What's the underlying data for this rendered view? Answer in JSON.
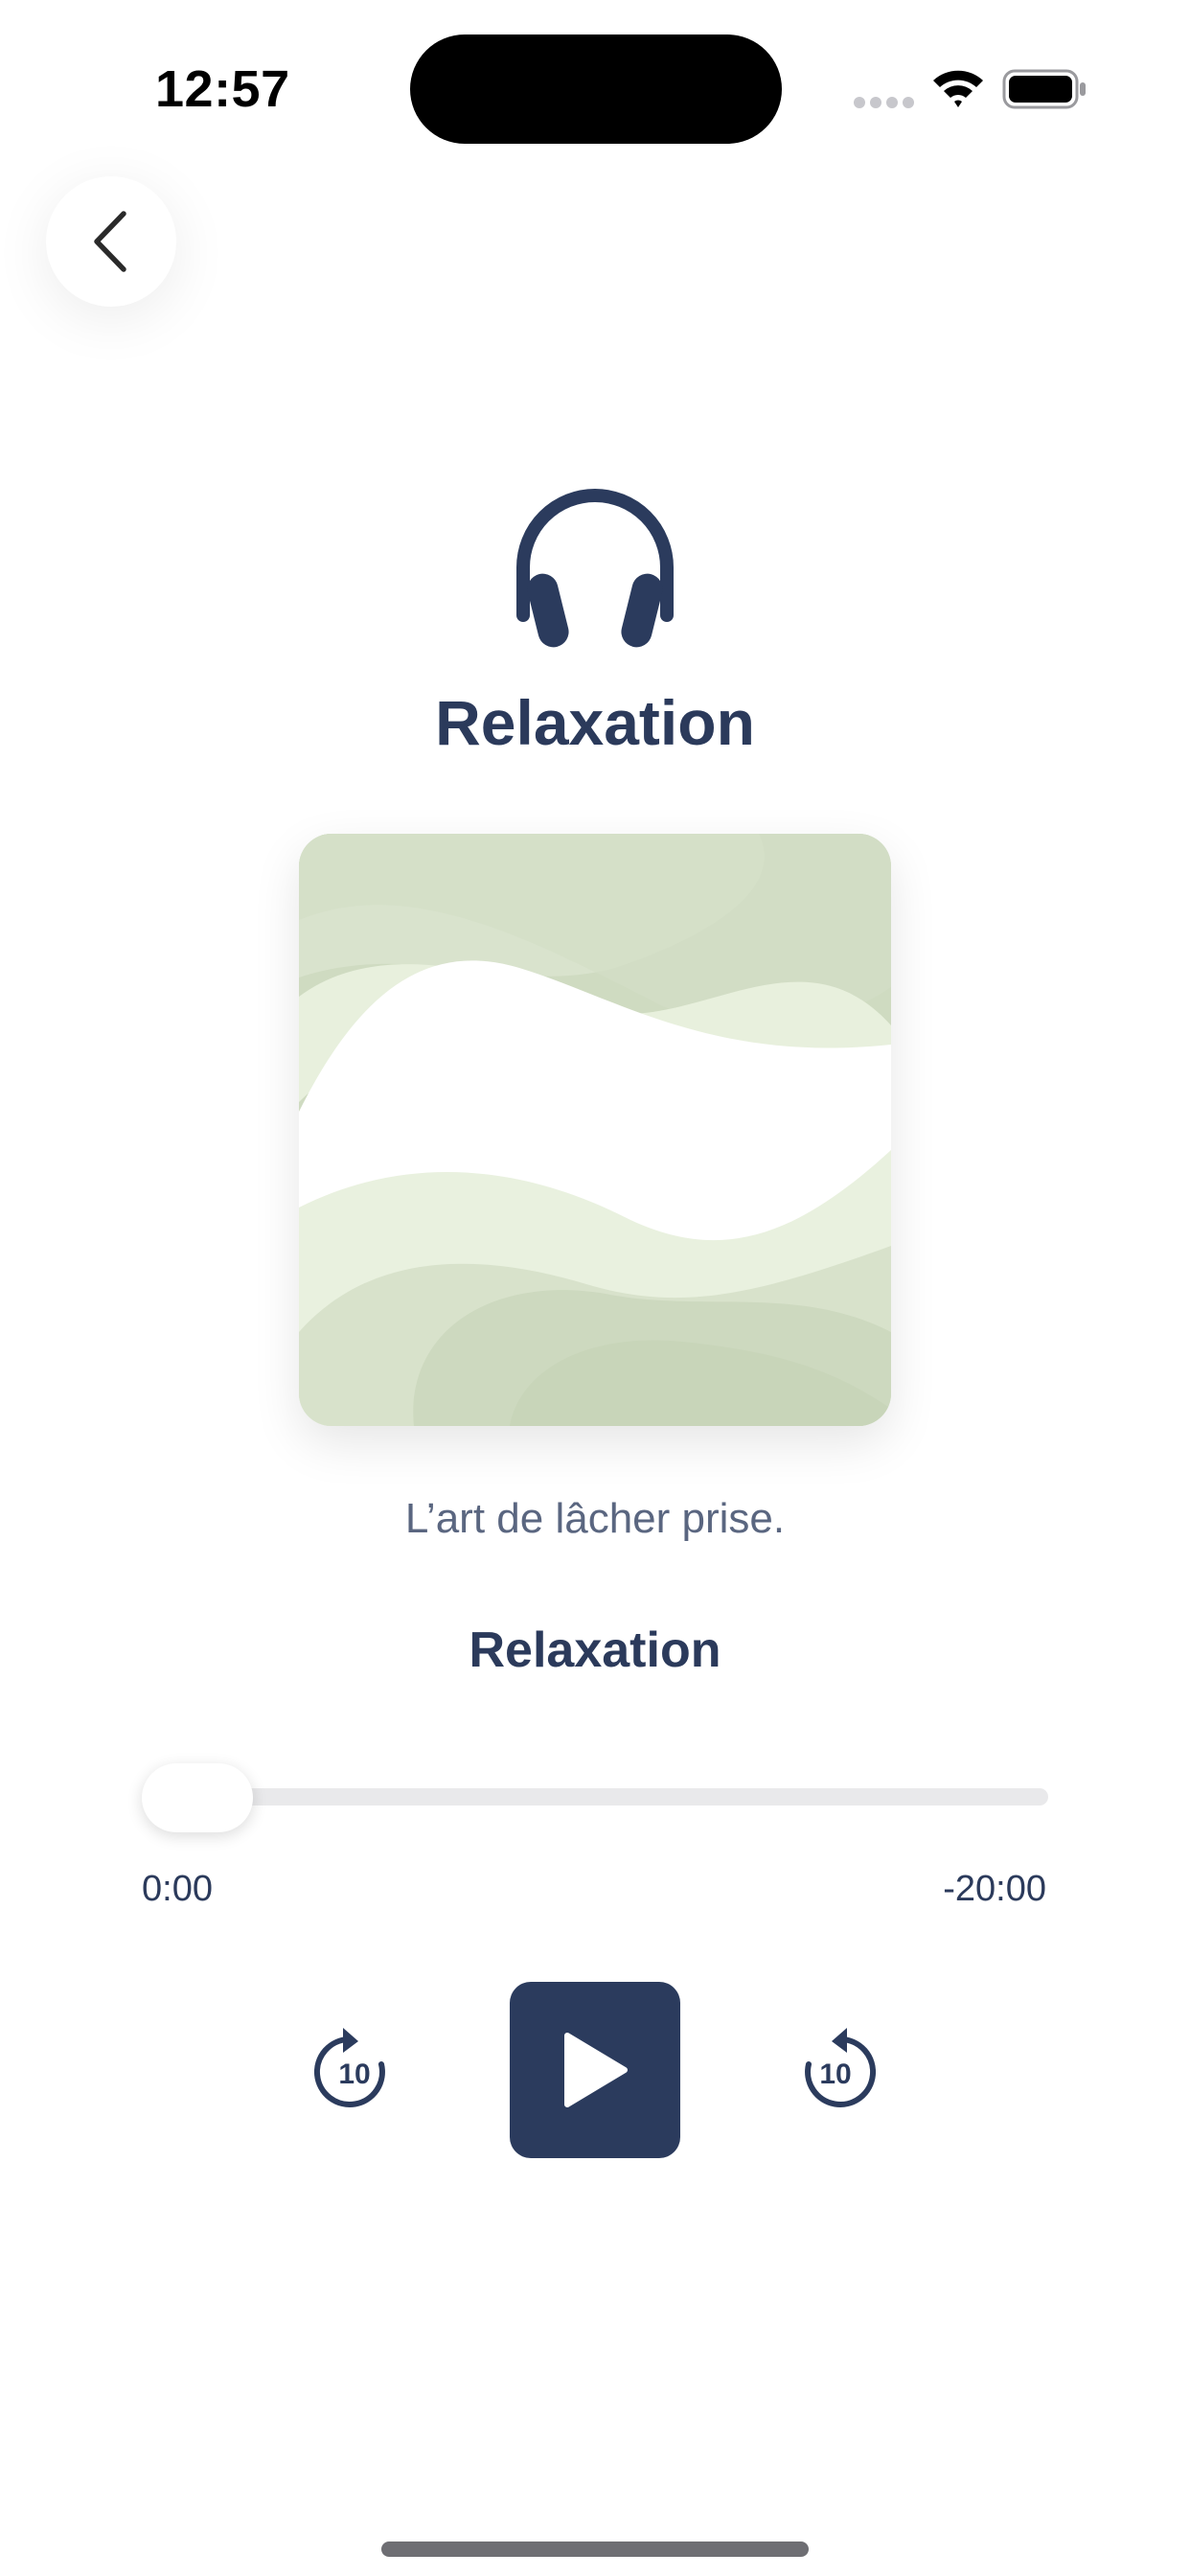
{
  "status_bar": {
    "time": "12:57"
  },
  "header": {
    "back_icon": "chevron-left-icon",
    "category_icon": "headphones-icon",
    "title": "Relaxation"
  },
  "artwork": {
    "description_icon": "abstract-waves-artwork",
    "colors": {
      "light_green": "#e9f1df",
      "mid_green": "#d8e2cb",
      "dark_green": "#c9d7bb",
      "white": "#ffffff"
    }
  },
  "track": {
    "subtitle": "L’art de lâcher prise.",
    "name": "Relaxation"
  },
  "player": {
    "progress_fraction": 0.0,
    "elapsed": "0:00",
    "remaining": "-20:00",
    "skip_back_label": "10",
    "skip_forward_label": "10",
    "play_icon": "play-icon",
    "skip_back_icon": "rewind-10-icon",
    "skip_forward_icon": "forward-10-icon"
  },
  "colors": {
    "primary": "#2b3b5d",
    "text_secondary": "#5a6680",
    "track_bg": "#e9e9eb"
  }
}
